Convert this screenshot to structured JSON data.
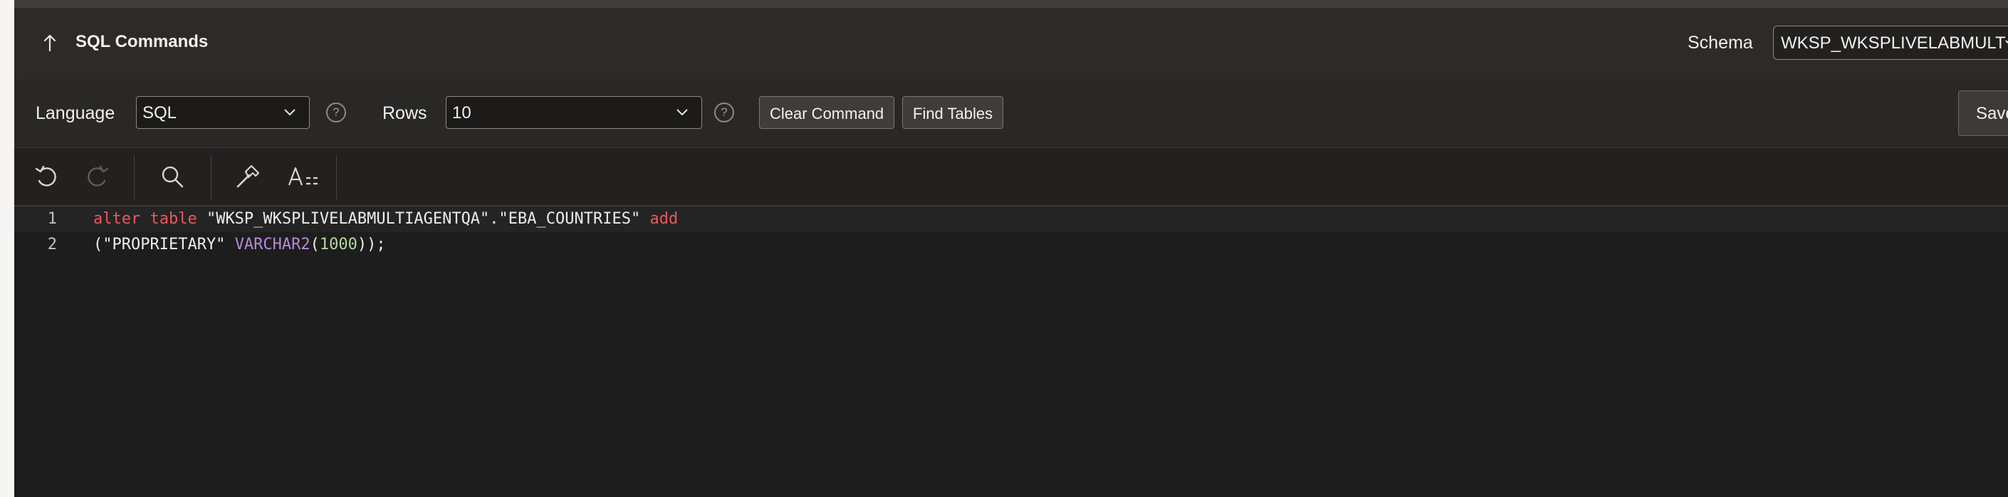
{
  "header": {
    "title": "SQL Commands",
    "schema_label": "Schema",
    "schema_value": "WKSP_WKSPLIVELABMULT"
  },
  "toolbar": {
    "language_label": "Language",
    "language_value": "SQL",
    "rows_label": "Rows",
    "rows_value": "10",
    "help_glyph": "?",
    "clear_command": "Clear Command",
    "find_tables": "Find Tables",
    "save": "Save"
  },
  "editor_tools": [
    "undo-icon",
    "redo-icon",
    "search-icon",
    "hammer-icon",
    "text-format-icon"
  ],
  "editor": {
    "lines": [
      {
        "number": "1",
        "tokens": [
          {
            "type": "kw",
            "text": "alter table"
          },
          {
            "type": "plain",
            "text": " \"WKSP_WKSPLIVELABMULTIAGENTQA\".\"EBA_COUNTRIES\" "
          },
          {
            "type": "kw",
            "text": "add"
          }
        ]
      },
      {
        "number": "2",
        "tokens": [
          {
            "type": "plain",
            "text": "(\"PROPRIETARY\" "
          },
          {
            "type": "fn",
            "text": "VARCHAR2"
          },
          {
            "type": "plain",
            "text": "("
          },
          {
            "type": "num",
            "text": "1000"
          },
          {
            "type": "plain",
            "text": "));"
          }
        ]
      }
    ]
  },
  "colors": {
    "keyword": "#e8585a",
    "type": "#b68bd8",
    "number": "#b5d99c"
  }
}
